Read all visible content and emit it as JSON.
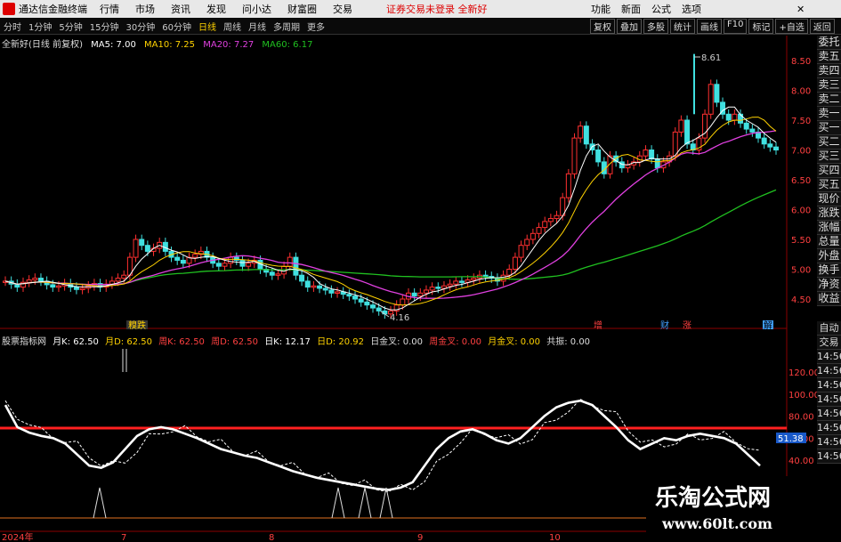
{
  "menubar": {
    "app_title": "通达信金融终端",
    "items": [
      "行情",
      "市场",
      "资讯",
      "发现",
      "问小达",
      "财富圈",
      "交易"
    ],
    "alert": "证券交易未登录 全新好",
    "right_items": [
      "功能",
      "新面",
      "公式",
      "选项"
    ],
    "close": "✕"
  },
  "toolbar": {
    "periods": [
      "分时",
      "1分钟",
      "5分钟",
      "15分钟",
      "30分钟",
      "60分钟",
      "日线",
      "周线",
      "月线",
      "多周期",
      "更多"
    ],
    "active_period": "日线",
    "right_tools": [
      "复权",
      "叠加",
      "多股",
      "统计",
      "画线",
      "F10",
      "标记",
      "+自选",
      "返回"
    ]
  },
  "legend": {
    "title": "全新好(日线 前复权)",
    "ma5": "MA5: 7.00",
    "ma10": "MA10: 7.25",
    "ma20": "MA20: 7.27",
    "ma60": "MA60: 6.17"
  },
  "colors": {
    "ma5": "#ffffff",
    "ma10": "#ffd200",
    "ma20": "#e040e0",
    "ma60": "#20c020",
    "up": "#ff3030",
    "down": "#40e0e0"
  },
  "price_axis": [
    "8.50",
    "8.00",
    "7.50",
    "7.00",
    "6.50",
    "6.00",
    "5.50",
    "5.00",
    "4.50"
  ],
  "price_marks": {
    "high": "8.61",
    "low": "4.16"
  },
  "events": {
    "e1": "糗跌",
    "e2": "增",
    "e3": "财",
    "e4": "涨",
    "e5": "解"
  },
  "right_panel": [
    "委托",
    "卖五",
    "卖四",
    "卖三",
    "卖二",
    "卖一",
    "买一",
    "买二",
    "买三",
    "买四",
    "买五",
    "现价",
    "涨跌",
    "涨幅",
    "总量",
    "外盘",
    "换手",
    "净资",
    "收益"
  ],
  "indicator": {
    "name": "股票指标网",
    "month_k": "月K: 62.50",
    "month_d": "月D: 62.50",
    "week_k": "周K: 62.50",
    "week_d": "周D: 62.50",
    "day_k": "日K: 12.17",
    "day_d": "日D: 20.92",
    "day_cross": "日金叉: 0.00",
    "week_cross": "周金叉: 0.00",
    "month_cross": "月金叉: 0.00",
    "resonance": "共振: 0.00",
    "axis": [
      "120.00",
      "100.00",
      "80.00",
      "60.00",
      "40.00"
    ],
    "current": "51.38",
    "side_labels": [
      "自动",
      "交易",
      "14:56",
      "14:56",
      "14:56",
      "14:56",
      "14:56",
      "14:56",
      "14:56",
      "14:56"
    ]
  },
  "date_axis": [
    "2024年",
    "7",
    "8",
    "9",
    "10"
  ],
  "watermark": {
    "name": "乐淘公式网",
    "url": "www.60lt.com"
  }
}
